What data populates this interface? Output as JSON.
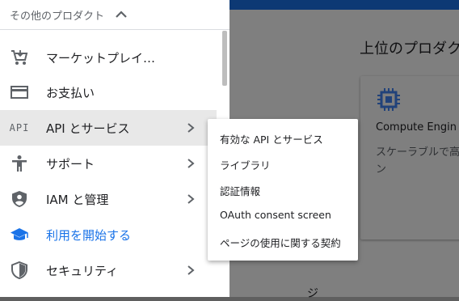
{
  "background": {
    "section_title": "上位のプロダク",
    "card_title": "Compute Engin",
    "card_desc": "スケーラブルで高\nン",
    "bottom_text": "ジ"
  },
  "drawer": {
    "section_label": "その他のプロダクト",
    "items": [
      {
        "label": "マーケットプレイ…",
        "icon": "cart-icon",
        "has_arrow": false
      },
      {
        "label": "お支払い",
        "icon": "credit-card-icon",
        "has_arrow": false
      },
      {
        "label": "API とサービス",
        "icon": "api-icon",
        "icon_text": "API",
        "has_arrow": true,
        "active": true
      },
      {
        "label": "サポート",
        "icon": "person-icon",
        "has_arrow": true
      },
      {
        "label": "IAM と管理",
        "icon": "shield-person-icon",
        "has_arrow": true
      },
      {
        "label": "利用を開始する",
        "icon": "graduation-cap-icon",
        "has_arrow": false,
        "color": "#1a73e8"
      },
      {
        "label": "セキュリティ",
        "icon": "security-shield-icon",
        "has_arrow": true
      }
    ]
  },
  "submenu": {
    "items": [
      "有効な API とサービス",
      "ライブラリ",
      "認証情報",
      "OAuth consent screen",
      "ページの使用に関する契約"
    ]
  },
  "colors": {
    "accent": "#1a73e8",
    "active_bg": "#e8e8e8",
    "icon_gray": "#5f6368"
  }
}
